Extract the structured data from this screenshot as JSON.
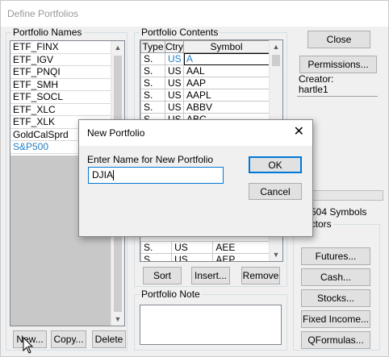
{
  "window": {
    "title": "Define Portfolios"
  },
  "portfolio_names": {
    "label": "Portfolio Names",
    "items": [
      "ETF_FINX",
      "ETF_IGV",
      "ETF_PNQI",
      "ETF_SMH",
      "ETF_SOCL",
      "ETF_XLC",
      "ETF_XLK",
      "GoldCalSprd",
      "S&P500"
    ],
    "selected_index": 8
  },
  "portfolio_contents": {
    "label": "Portfolio Contents",
    "columns": [
      "Type",
      "Ctry",
      "Symbol"
    ],
    "rows_top": [
      {
        "type": "S.",
        "ctry": "US",
        "symbol": "A"
      },
      {
        "type": "S.",
        "ctry": "US",
        "symbol": "AAL"
      },
      {
        "type": "S.",
        "ctry": "US",
        "symbol": "AAP"
      },
      {
        "type": "S.",
        "ctry": "US",
        "symbol": "AAPL"
      },
      {
        "type": "S.",
        "ctry": "US",
        "symbol": "ABBV"
      },
      {
        "type": "S.",
        "ctry": "US",
        "symbol": "ABC"
      }
    ],
    "rows_bottom": [
      {
        "type": "S.",
        "ctry": "US",
        "symbol": "AEE"
      },
      {
        "type": "S.",
        "ctry": "US",
        "symbol": "AEP"
      }
    ]
  },
  "buttons": {
    "close": "Close",
    "permissions": "Permissions...",
    "sort": "Sort",
    "insert": "Insert...",
    "remove": "Remove",
    "new": "New...",
    "copy": "Copy...",
    "delete": "Delete",
    "futures": "Futures...",
    "cash": "Cash...",
    "stocks": "Stocks...",
    "fixed_income": "Fixed Income...",
    "qformulas": "QFormulas..."
  },
  "creator": {
    "label": "Creator:",
    "value": "hartle1"
  },
  "symbols_count": "504 Symbols",
  "selectors_label": "ectors",
  "portfolio_note": {
    "label": "Portfolio Note",
    "value": ""
  },
  "dialog": {
    "title": "New Portfolio",
    "close_glyph": "✕",
    "prompt": "Enter Name for New Portfolio",
    "input_value": "DJIA",
    "ok": "OK",
    "cancel": "Cancel"
  }
}
